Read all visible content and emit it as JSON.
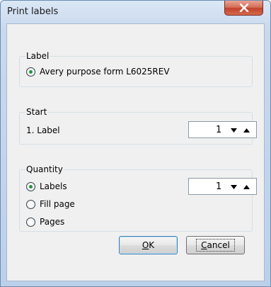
{
  "window": {
    "title": "Print labels"
  },
  "label_group": {
    "legend": "Label",
    "option": "Avery purpose form L6025REV"
  },
  "start_group": {
    "legend": "Start",
    "field_label": "1. Label",
    "value": "1"
  },
  "quantity_group": {
    "legend": "Quantity",
    "options": [
      "Labels",
      "Fill page",
      "Pages"
    ],
    "selected": "Labels",
    "value": "1"
  },
  "buttons": {
    "ok": {
      "mnemonic": "O",
      "rest": "K"
    },
    "cancel": {
      "mnemonic": "C",
      "rest": "ancel"
    }
  },
  "icons": {
    "close": "close-icon",
    "spin_down": "triangle-down-icon",
    "spin_up": "triangle-up-icon"
  }
}
